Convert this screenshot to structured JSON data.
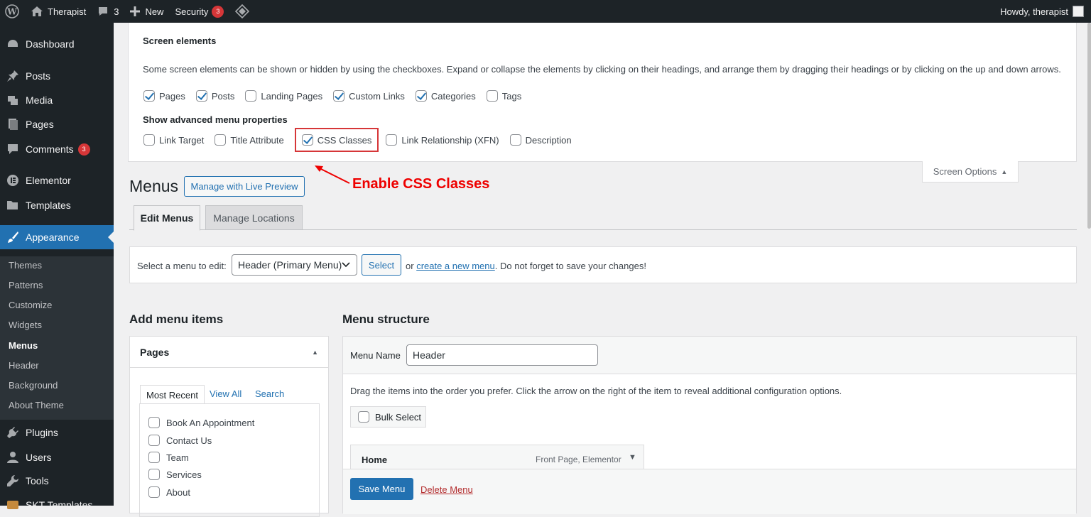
{
  "admin_bar": {
    "site_name": "Therapist",
    "comments_count": "3",
    "new_label": "New",
    "security_label": "Security",
    "security_count": "3",
    "howdy": "Howdy, therapist"
  },
  "sidebar": {
    "items": [
      {
        "label": "Dashboard",
        "icon": "dashboard-icon"
      },
      {
        "label": "Posts",
        "icon": "pin-icon"
      },
      {
        "label": "Media",
        "icon": "media-icon"
      },
      {
        "label": "Pages",
        "icon": "page-icon"
      },
      {
        "label": "Comments",
        "icon": "comment-icon",
        "badge": "3"
      },
      {
        "label": "Elementor",
        "icon": "elementor-icon"
      },
      {
        "label": "Templates",
        "icon": "folder-icon"
      },
      {
        "label": "Appearance",
        "icon": "brush-icon"
      },
      {
        "label": "Plugins",
        "icon": "plugin-icon"
      },
      {
        "label": "Users",
        "icon": "user-icon"
      },
      {
        "label": "Tools",
        "icon": "wrench-icon"
      },
      {
        "label": "SKT Templates",
        "icon": "skt-icon"
      }
    ],
    "submenu": [
      "Themes",
      "Patterns",
      "Customize",
      "Widgets",
      "Menus",
      "Header",
      "Background",
      "About Theme"
    ],
    "submenu_active": "Menus"
  },
  "screen_options": {
    "heading": "Screen elements",
    "description": "Some screen elements can be shown or hidden by using the checkboxes. Expand or collapse the elements by clicking on their headings, and arrange them by dragging their headings or by clicking on the up and down arrows.",
    "elements": [
      {
        "label": "Pages",
        "checked": true
      },
      {
        "label": "Posts",
        "checked": true
      },
      {
        "label": "Landing Pages",
        "checked": false
      },
      {
        "label": "Custom Links",
        "checked": true
      },
      {
        "label": "Categories",
        "checked": true
      },
      {
        "label": "Tags",
        "checked": false
      }
    ],
    "advanced_heading": "Show advanced menu properties",
    "advanced": [
      {
        "label": "Link Target",
        "checked": false
      },
      {
        "label": "Title Attribute",
        "checked": false
      },
      {
        "label": "CSS Classes",
        "checked": true
      },
      {
        "label": "Link Relationship (XFN)",
        "checked": false
      },
      {
        "label": "Description",
        "checked": false
      }
    ],
    "tab_label": "Screen Options"
  },
  "annotation": "Enable CSS Classes",
  "page": {
    "title": "Menus",
    "live_preview": "Manage with Live Preview",
    "tabs": [
      "Edit Menus",
      "Manage Locations"
    ]
  },
  "select_bar": {
    "label": "Select a menu to edit:",
    "selected": "Header (Primary Menu)",
    "button": "Select",
    "or": "or",
    "create_link": "create a new menu",
    "suffix": ". Do not forget to save your changes!"
  },
  "add_items": {
    "title": "Add menu items",
    "box_title": "Pages",
    "tabs": [
      "Most Recent",
      "View All",
      "Search"
    ],
    "pages": [
      "Book An Appointment",
      "Contact Us",
      "Team",
      "Services",
      "About"
    ]
  },
  "structure": {
    "title": "Menu structure",
    "name_label": "Menu Name",
    "name_value": "Header",
    "instructions": "Drag the items into the order you prefer. Click the arrow on the right of the item to reveal additional configuration options.",
    "bulk_select": "Bulk Select",
    "item_title": "Home",
    "item_type": "Front Page, Elementor",
    "save": "Save Menu",
    "delete": "Delete Menu"
  }
}
